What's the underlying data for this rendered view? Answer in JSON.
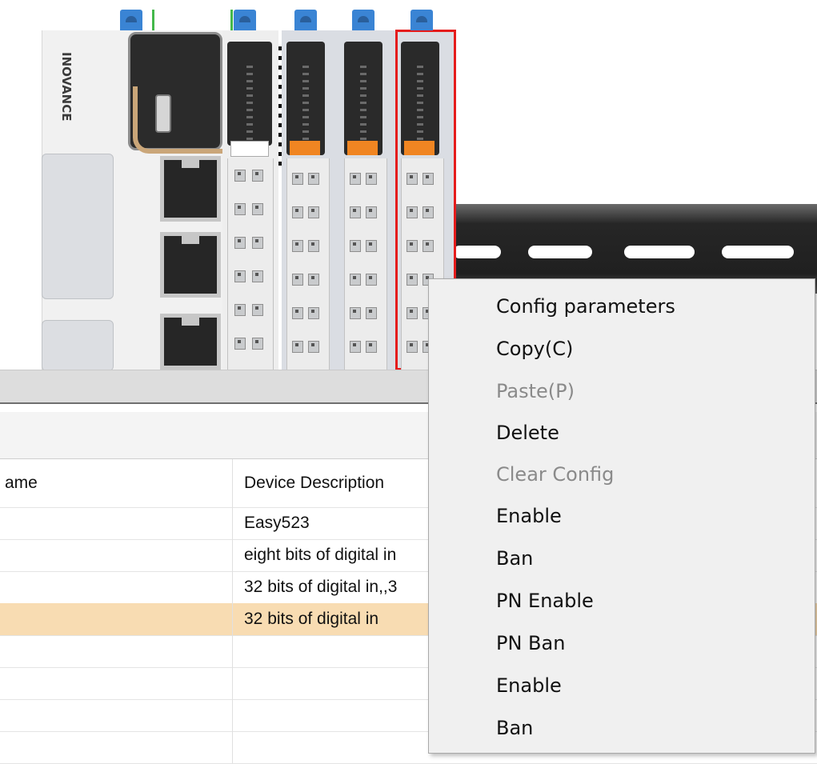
{
  "hardware": {
    "brand": "INOVANCE",
    "selected_module_index": 3
  },
  "table": {
    "columns": [
      "ame",
      "Device Description"
    ],
    "rows": [
      {
        "name": "",
        "description": "Easy523",
        "highlight": false
      },
      {
        "name": "",
        "description": "eight bits of digital in",
        "highlight": false
      },
      {
        "name": "",
        "description": "32 bits of digital in,,3",
        "highlight": false
      },
      {
        "name": "",
        "description": "32 bits of digital in",
        "highlight": true
      },
      {
        "name": "",
        "description": "",
        "highlight": false
      },
      {
        "name": "",
        "description": "",
        "highlight": false
      },
      {
        "name": "",
        "description": "",
        "highlight": false
      },
      {
        "name": "",
        "description": "",
        "highlight": false
      }
    ]
  },
  "context_menu": {
    "items": [
      {
        "label": "Config parameters",
        "enabled": true
      },
      {
        "label": "Copy(C)",
        "enabled": true
      },
      {
        "label": "Paste(P)",
        "enabled": false
      },
      {
        "label": "Delete",
        "enabled": true
      },
      {
        "label": "Clear Config",
        "enabled": false
      },
      {
        "label": "Enable",
        "enabled": true
      },
      {
        "label": "Ban",
        "enabled": true
      },
      {
        "label": "PN Enable",
        "enabled": true
      },
      {
        "label": "PN Ban",
        "enabled": true
      },
      {
        "label": "Enable",
        "enabled": true
      },
      {
        "label": "Ban",
        "enabled": true
      }
    ]
  },
  "colors": {
    "selection_outline": "#e51c1c",
    "highlight_row": "#f8dcb2",
    "module_indicator": "#f08522",
    "connector_tab": "#3a84d4"
  }
}
